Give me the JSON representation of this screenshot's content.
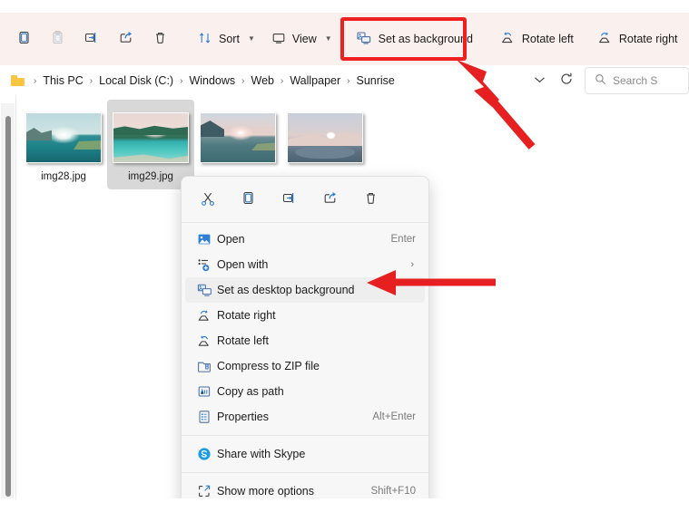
{
  "toolbar": {
    "icon_buttons": [
      {
        "name": "copy-button",
        "icon": "copy-icon",
        "enabled": true
      },
      {
        "name": "paste-button",
        "icon": "paste-icon",
        "enabled": false
      },
      {
        "name": "rename-button",
        "icon": "rename-icon",
        "enabled": true
      },
      {
        "name": "share-button",
        "icon": "share-icon",
        "enabled": true
      },
      {
        "name": "delete-button",
        "icon": "trash-icon",
        "enabled": true
      }
    ],
    "sort_label": "Sort",
    "view_label": "View",
    "set_as_background_label": "Set as background",
    "rotate_left_label": "Rotate left",
    "rotate_right_label": "Rotate right",
    "overflow_label": "•••",
    "highlight_color": "#ee2020",
    "background_color": "#faf0ee"
  },
  "address_bar": {
    "crumbs": [
      "This PC",
      "Local Disk (C:)",
      "Windows",
      "Web",
      "Wallpaper",
      "Sunrise"
    ],
    "separator": "›",
    "search_placeholder": "Search S"
  },
  "files": [
    {
      "name": "img28.jpg",
      "selected": false
    },
    {
      "name": "img29.jpg",
      "selected": true
    },
    {
      "name": "",
      "selected": false
    },
    {
      "name": "",
      "selected": false
    }
  ],
  "context_menu": {
    "quick_actions": [
      {
        "name": "cut-button",
        "icon": "scissors-icon"
      },
      {
        "name": "copy-button",
        "icon": "copy-icon"
      },
      {
        "name": "rename-button",
        "icon": "rename-icon"
      },
      {
        "name": "share-button",
        "icon": "share-icon"
      },
      {
        "name": "delete-button",
        "icon": "trash-icon"
      }
    ],
    "items": [
      {
        "label": "Open",
        "accel": "Enter",
        "icon": "photo-icon",
        "submenu": false,
        "highlight": false
      },
      {
        "label": "Open with",
        "accel": "",
        "icon": "open-with-icon",
        "submenu": true,
        "highlight": false
      },
      {
        "label": "Set as desktop background",
        "accel": "",
        "icon": "monitor-icon",
        "submenu": false,
        "highlight": true
      },
      {
        "label": "Rotate right",
        "accel": "",
        "icon": "rotate-right-icon",
        "submenu": false,
        "highlight": false
      },
      {
        "label": "Rotate left",
        "accel": "",
        "icon": "rotate-left-icon",
        "submenu": false,
        "highlight": false
      },
      {
        "label": "Compress to ZIP file",
        "accel": "",
        "icon": "zip-icon",
        "submenu": false,
        "highlight": false
      },
      {
        "label": "Copy as path",
        "accel": "",
        "icon": "copy-path-icon",
        "submenu": false,
        "highlight": false
      },
      {
        "label": "Properties",
        "accel": "Alt+Enter",
        "icon": "properties-icon",
        "submenu": false,
        "highlight": false
      }
    ],
    "skype_item": {
      "label": "Share with Skype",
      "icon": "skype-icon"
    },
    "more_item": {
      "label": "Show more options",
      "accel": "Shift+F10",
      "icon": "show-more-icon"
    }
  }
}
